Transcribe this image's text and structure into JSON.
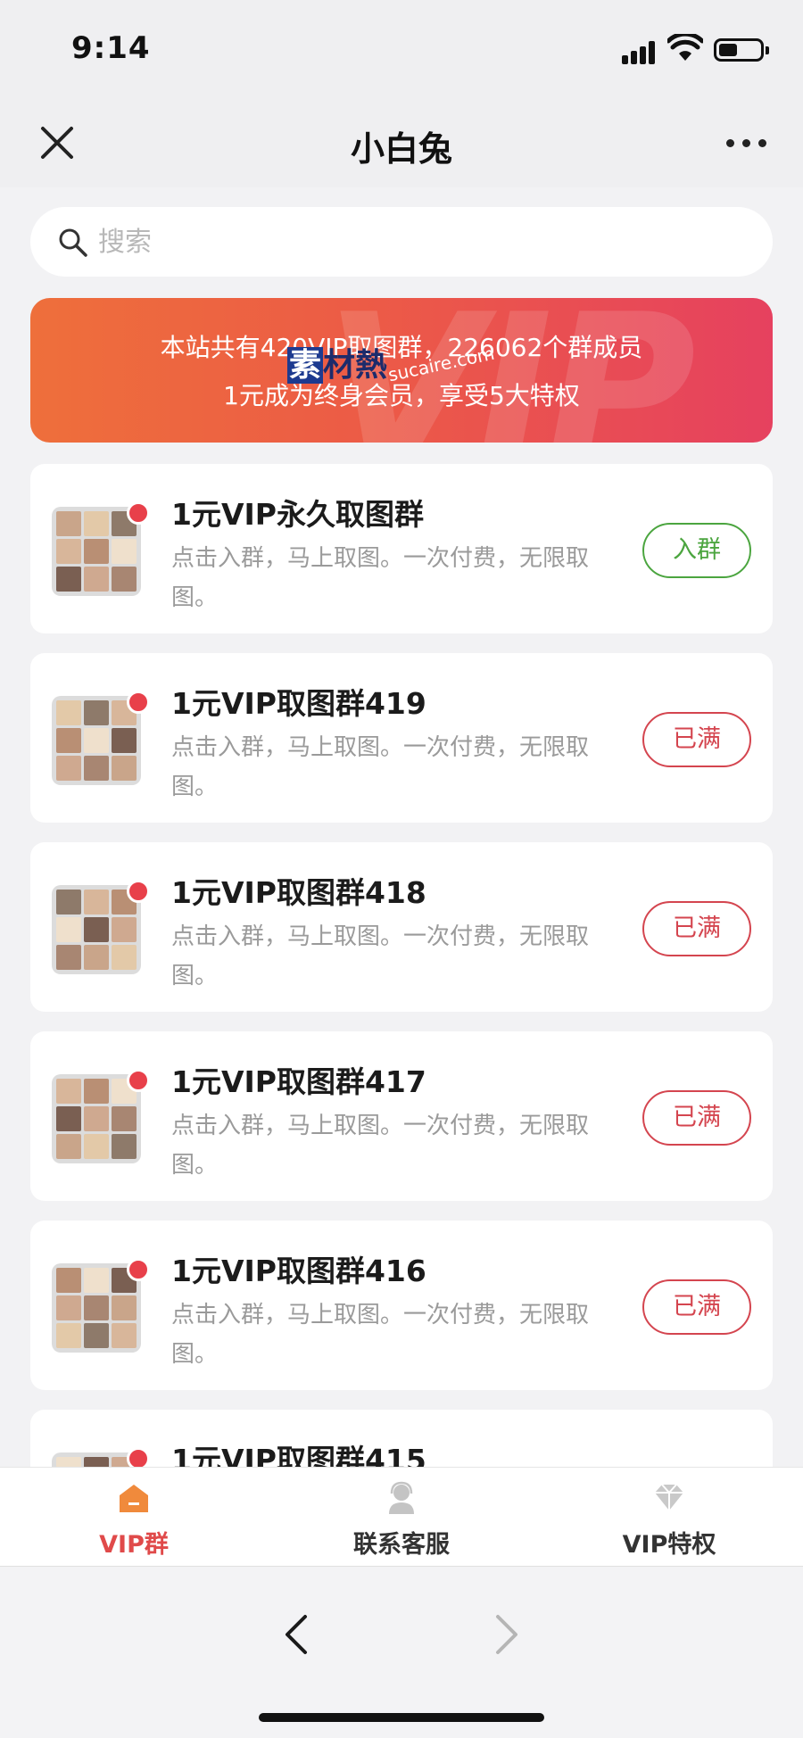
{
  "status_bar": {
    "time": "9:14"
  },
  "nav": {
    "title": "小白兔"
  },
  "search": {
    "placeholder": "搜索"
  },
  "banner": {
    "line1": "本站共有420VIP取图群，226062个群成员",
    "line2": "1元成为终身会员，享受5大特权",
    "bg_text": "VIP",
    "watermark_main": "素材熱",
    "watermark_sub": "sucaire.com"
  },
  "groups": [
    {
      "title": "1元VIP永久取图群",
      "desc": "点击入群，马上取图。一次付费，无限取图。",
      "button": "入群",
      "status": "join"
    },
    {
      "title": "1元VIP取图群419",
      "desc": "点击入群，马上取图。一次付费，无限取图。",
      "button": "已满",
      "status": "full"
    },
    {
      "title": "1元VIP取图群418",
      "desc": "点击入群，马上取图。一次付费，无限取图。",
      "button": "已满",
      "status": "full"
    },
    {
      "title": "1元VIP取图群417",
      "desc": "点击入群，马上取图。一次付费，无限取图。",
      "button": "已满",
      "status": "full"
    },
    {
      "title": "1元VIP取图群416",
      "desc": "点击入群，马上取图。一次付费，无限取图。",
      "button": "已满",
      "status": "full"
    },
    {
      "title": "1元VIP取图群415",
      "desc": "",
      "button": "",
      "status": "partial"
    }
  ],
  "tabs": [
    {
      "label": "VIP群",
      "icon": "house-icon",
      "active": true
    },
    {
      "label": "联系客服",
      "icon": "customer-service-icon",
      "active": false
    },
    {
      "label": "VIP特权",
      "icon": "diamond-icon",
      "active": false
    }
  ],
  "colors": {
    "active_tab": "#e04a4a",
    "inactive_tab": "#333333",
    "join_green": "#4ba53f",
    "full_red": "#d4454f",
    "banner_start": "#ee6f3b",
    "banner_end": "#e6415f"
  }
}
